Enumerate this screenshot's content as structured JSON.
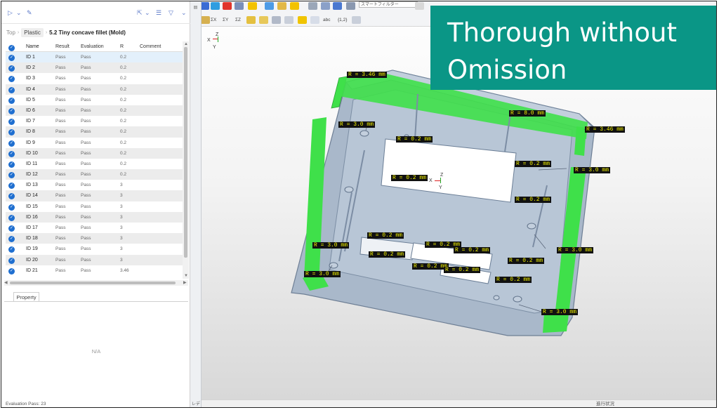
{
  "toolbar": {
    "icons": [
      "play-icon",
      "dropdown-icon",
      "edit-icon",
      "export-icon",
      "filter-list-icon",
      "filter-icon",
      "collapse-icon"
    ]
  },
  "breadcrumb": {
    "top": "Top",
    "plastic": "Plastic",
    "title": "5.2 Tiny concave fillet (Mold)"
  },
  "table": {
    "headers": {
      "name": "Name",
      "result": "Result",
      "evaluation": "Evaluation",
      "r": "R",
      "comment": "Comment"
    },
    "rows": [
      {
        "name": "ID 1",
        "result": "Pass",
        "evaluation": "Pass",
        "r": "0.2"
      },
      {
        "name": "ID 2",
        "result": "Pass",
        "evaluation": "Pass",
        "r": "0.2"
      },
      {
        "name": "ID 3",
        "result": "Pass",
        "evaluation": "Pass",
        "r": "0.2"
      },
      {
        "name": "ID 4",
        "result": "Pass",
        "evaluation": "Pass",
        "r": "0.2"
      },
      {
        "name": "ID 5",
        "result": "Pass",
        "evaluation": "Pass",
        "r": "0.2"
      },
      {
        "name": "ID 6",
        "result": "Pass",
        "evaluation": "Pass",
        "r": "0.2"
      },
      {
        "name": "ID 7",
        "result": "Pass",
        "evaluation": "Pass",
        "r": "0.2"
      },
      {
        "name": "ID 8",
        "result": "Pass",
        "evaluation": "Pass",
        "r": "0.2"
      },
      {
        "name": "ID 9",
        "result": "Pass",
        "evaluation": "Pass",
        "r": "0.2"
      },
      {
        "name": "ID 10",
        "result": "Pass",
        "evaluation": "Pass",
        "r": "0.2"
      },
      {
        "name": "ID 11",
        "result": "Pass",
        "evaluation": "Pass",
        "r": "0.2"
      },
      {
        "name": "ID 12",
        "result": "Pass",
        "evaluation": "Pass",
        "r": "0.2"
      },
      {
        "name": "ID 13",
        "result": "Pass",
        "evaluation": "Pass",
        "r": "3"
      },
      {
        "name": "ID 14",
        "result": "Pass",
        "evaluation": "Pass",
        "r": "3"
      },
      {
        "name": "ID 15",
        "result": "Pass",
        "evaluation": "Pass",
        "r": "3"
      },
      {
        "name": "ID 16",
        "result": "Pass",
        "evaluation": "Pass",
        "r": "3"
      },
      {
        "name": "ID 17",
        "result": "Pass",
        "evaluation": "Pass",
        "r": "3"
      },
      {
        "name": "ID 18",
        "result": "Pass",
        "evaluation": "Pass",
        "r": "3"
      },
      {
        "name": "ID 19",
        "result": "Pass",
        "evaluation": "Pass",
        "r": "3"
      },
      {
        "name": "ID 20",
        "result": "Pass",
        "evaluation": "Pass",
        "r": "3"
      },
      {
        "name": "ID 21",
        "result": "Pass",
        "evaluation": "Pass",
        "r": "3.46"
      }
    ]
  },
  "property": {
    "tab": "Property",
    "empty": "N/A"
  },
  "status": {
    "left": "Evaluation  Pass: 23",
    "ready": "レディ",
    "view_right": "進行状況"
  },
  "view_toolbar": {
    "filter": "スマートフィルター",
    "items": [
      "ΣX",
      "ΣY",
      "ΣZ",
      "abc",
      "{1,2}"
    ]
  },
  "viewport": {
    "axis_x": "X",
    "axis_y": "Y",
    "axis_z": "Z",
    "labels": [
      "R = 3.46 mm",
      "R = 8.0 mm",
      "R = 3.46 mm",
      "R = 3.0 mm",
      "R = 0.2 mm",
      "R = 0.2 mm",
      "R = 0.2 mm",
      "R = 3.0 mm",
      "R = 0.2 mm",
      "R = 0.2 mm",
      "R = 3.0 mm",
      "R = 0.2 mm",
      "R = 0.2 mm",
      "R = 0.2 mm",
      "R = 3.0 mm",
      "R = 0.2 mm",
      "R = 0.2 mm",
      "R = 0.2 mm",
      "R = 3.0 mm",
      "R = 0.2 mm",
      "R = 3.0 mm"
    ]
  },
  "banner": {
    "text": "Thorough without\nOmission"
  },
  "colors": {
    "highlight_green": "#3fe04a",
    "model_blue": "#aebfd3",
    "banner_teal": "#0a9686",
    "check_blue": "#1f6fd0",
    "label_yellow": "#f0f000"
  }
}
